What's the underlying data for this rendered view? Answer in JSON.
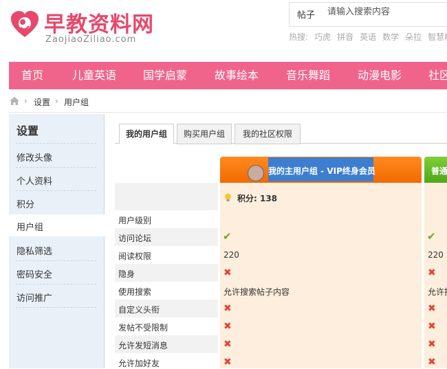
{
  "header": {
    "logo_title": "早教资料网",
    "logo_sub": "ZaojiaoZiliao.com",
    "search_type": "帖子",
    "search_placeholder": "请输入搜索内容",
    "hot_label": "热搜:",
    "hot_terms": [
      "巧虎",
      "拼音",
      "英语",
      "数学",
      "朵拉",
      "智慧树"
    ]
  },
  "nav": [
    "首页",
    "儿童英语",
    "国学启蒙",
    "故事绘本",
    "音乐舞蹈",
    "动漫电影",
    "社区"
  ],
  "breadcrumb": [
    "设置",
    "用户组"
  ],
  "sidebar": {
    "title": "设置",
    "items": [
      "修改头像",
      "个人资料",
      "积分",
      "用户组",
      "隐私筛选",
      "密码安全",
      "访问推广"
    ]
  },
  "tabs": [
    "我的用户组",
    "购买用户组",
    "我的社区权限"
  ],
  "groups": {
    "main": "我的主用户组 - VIP终身会员",
    "other": "普通"
  },
  "points": "积分: 138",
  "rows": [
    {
      "label": "用户级别",
      "c1": "",
      "c2": ""
    },
    {
      "label": "访问论坛",
      "c1": "check",
      "c2": "check"
    },
    {
      "label": "阅读权限",
      "c1": "220",
      "c2": "220"
    },
    {
      "label": "隐身",
      "c1": "cross",
      "c2": "cross"
    },
    {
      "label": "使用搜索",
      "c1": "允许搜索帖子内容",
      "c2": "允许搜"
    },
    {
      "label": "自定义头衔",
      "c1": "cross",
      "c2": "cross"
    },
    {
      "label": "发帖不受限制",
      "c1": "cross",
      "c2": "cross"
    },
    {
      "label": "允许发短消息",
      "c1": "cross",
      "c2": "cross"
    },
    {
      "label": "允许加好友",
      "c1": "cross",
      "c2": "cross"
    }
  ],
  "colors": {
    "brand": "#f0648c",
    "logo": "#e8486b"
  }
}
